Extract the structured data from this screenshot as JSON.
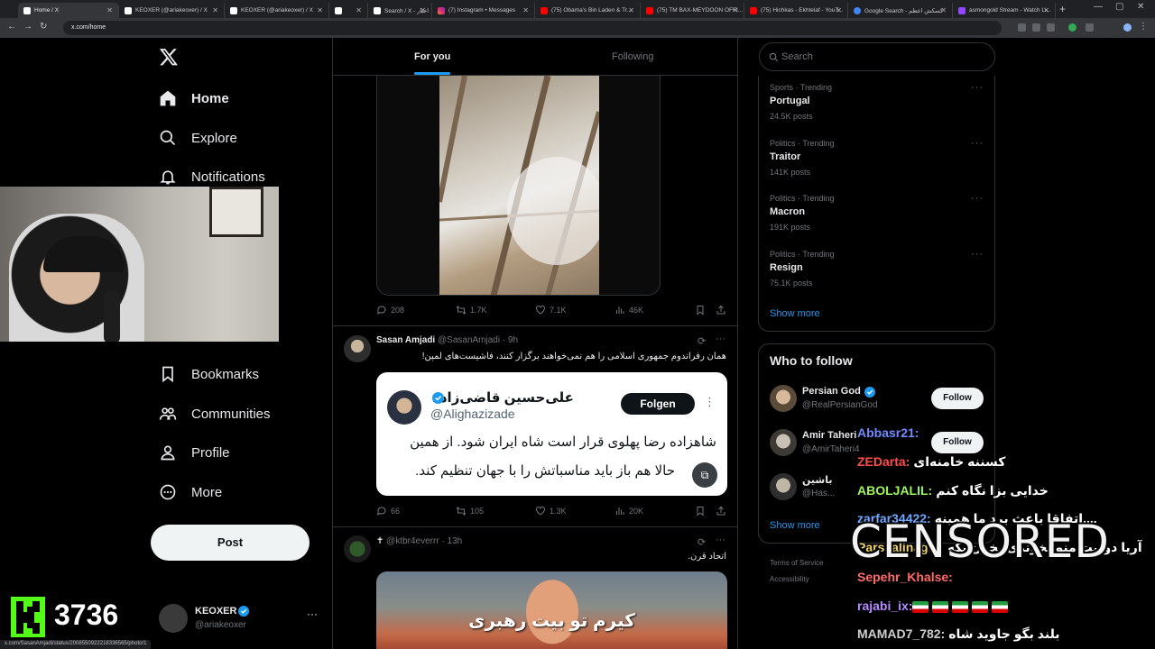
{
  "browser": {
    "tabs": [
      {
        "label": "Home / X",
        "fav": "x",
        "active": true
      },
      {
        "label": "KEOXER (@ariakeoxer) / X",
        "fav": "x"
      },
      {
        "label": "KEOXER (@ariakeoxer) / X",
        "fav": "x"
      },
      {
        "label": "",
        "fav": "x"
      },
      {
        "label": "Search / X - اخبار",
        "fav": "x"
      },
      {
        "label": "(7) Instagram • Messages",
        "fav": "ig"
      },
      {
        "label": "(75) Obama's Bin Laden & Tr...",
        "fav": "yt"
      },
      {
        "label": "(75) TM BAX-MEYDOON OFFI...",
        "fav": "yt"
      },
      {
        "label": "(75) Hichkas - Ekhtelaf - YouT...",
        "fav": "yt"
      },
      {
        "label": "Google Search - کسکش اعظم",
        "fav": "g"
      },
      {
        "label": "asmongold Stream - Watch Li...",
        "fav": "tw"
      }
    ],
    "url": "x.com/home",
    "status_url": "x.com/SasanAmjadi/status/2008550922218336565/photo/1"
  },
  "nav": {
    "home": "Home",
    "explore": "Explore",
    "notifications": "Notifications",
    "bookmarks": "Bookmarks",
    "communities": "Communities",
    "profile": "Profile",
    "more": "More",
    "post": "Post"
  },
  "account": {
    "name": "KEOXER",
    "handle": "@ariakeoxer"
  },
  "feed": {
    "tabs": {
      "for_you": "For you",
      "following": "Following"
    },
    "tweet1_stats": {
      "replies": "208",
      "reposts": "1.7K",
      "likes": "7.1K",
      "views": "46K"
    },
    "tweet2": {
      "name": "Sasan Amjadi",
      "handle": "@SasanAmjadi · 9h",
      "text": "همان رفراندوم جمهوری اسلامی را هم نمی‌خواهند برگزار کنند، فاشیست‌های لمپن!",
      "quote": {
        "name": "علی‌حسین قاضی‌زاده",
        "handle": "@Alighazizade",
        "follow": "Folgen",
        "line1": "شاهزاده رضا پهلوی قرار است شاه ایران شود. از همین",
        "line2": "حالا هم باز باید مناسباتش را با جهان تنظیم کند."
      },
      "stats": {
        "replies": "66",
        "reposts": "105",
        "likes": "1.3K",
        "views": "20K"
      }
    },
    "tweet3": {
      "name": "✝",
      "handle": "@ktbr4everrr · 13h",
      "text": "اتحاد قرن.",
      "caption": "کیرم تو بیت رهبری"
    }
  },
  "sidebar": {
    "search_placeholder": "Search",
    "trends": [
      {
        "meta": "Sports · Trending",
        "title": "Portugal",
        "count": "24.5K posts"
      },
      {
        "meta": "Politics · Trending",
        "title": "Traitor",
        "count": "141K posts"
      },
      {
        "meta": "Politics · Trending",
        "title": "Macron",
        "count": "191K posts"
      },
      {
        "meta": "Politics · Trending",
        "title": "Resign",
        "count": "75.1K posts"
      }
    ],
    "show_more": "Show more",
    "who_to_follow": {
      "title": "Who to follow",
      "items": [
        {
          "name": "Persian God",
          "handle": "@RealPersianGod",
          "button": "Follow"
        },
        {
          "name": "Amir Taheri",
          "handle": "@AmirTaheri4",
          "button": "Follow"
        },
        {
          "name": "باشین",
          "handle": "@Has..."
        }
      ],
      "show_more": "Show more"
    },
    "footer": {
      "terms": "Terms of Service",
      "accessibility": "Accessibility"
    }
  },
  "stream": {
    "viewers": "3736",
    "censored": "CENSORED",
    "chat": [
      {
        "user": "Abbasr21:",
        "text": "",
        "color": "#6e8bff"
      },
      {
        "user": "ZEDarta:",
        "text": "کسننه خامنه‌ای",
        "color": "#ff4d4d"
      },
      {
        "user": "ABOLJALIL:",
        "text": "خدایی بزا نگاه کنم",
        "color": "#9df55a"
      },
      {
        "user": "zarfar34422:",
        "text": "اتفاقا باعث برد ما همینه....",
        "color": "#6fa8ff"
      },
      {
        "user": "Parsaalinaghi:",
        "text": "آریا دونیت منو نخوندی بخون بکه",
        "color": "#f0d36b"
      },
      {
        "user": "Sepehr_Khalse:",
        "text": "",
        "color": "#ff6b6b"
      },
      {
        "user": "rajabi_ix:",
        "text": "",
        "color": "#b58cff"
      },
      {
        "user": "MAMAD7_782:",
        "text": "بلند بگو جاوید شاه",
        "color": "#cfcfcf"
      }
    ]
  }
}
